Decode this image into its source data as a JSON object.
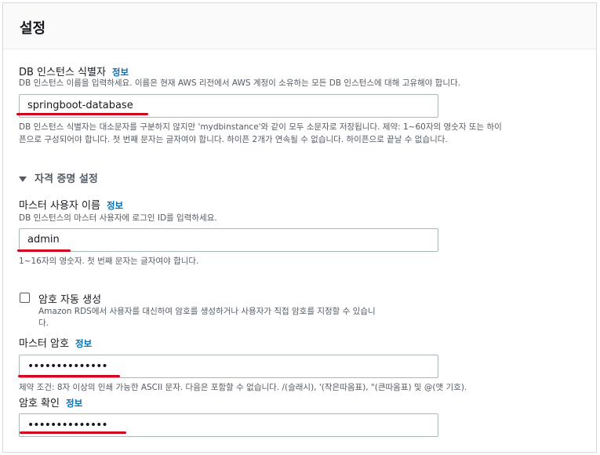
{
  "header": {
    "title": "설정"
  },
  "identifier": {
    "label": "DB 인스턴스 식별자",
    "info": "정보",
    "description": "DB 인스턴스 이름을 입력하세요. 이름은 현재 AWS 리전에서 AWS 계정이 소유하는 모든 DB 인스턴스에 대해 고유해야 합니다.",
    "value": "springboot-database",
    "constraint_line1": "DB 인스턴스 식별자는 대소문자를 구분하지 않지만 'mydbinstance'와 같이 모두 소문자로 저장됩니다. 제약: 1~60자의 영숫자 또는 하이",
    "constraint_line2": "픈으로 구성되어야 합니다. 첫 번째 문자는 글자여야 합니다. 하이픈 2개가 연속될 수 없습니다. 하이픈으로 끝날 수 없습니다."
  },
  "credentials": {
    "section_label": "자격 증명 설정",
    "username": {
      "label": "마스터 사용자 이름",
      "info": "정보",
      "description": "DB 인스턴스의 마스터 사용자에 로그인 ID를 입력하세요.",
      "value": "admin",
      "constraint": "1~16자의 영숫자. 첫 번째 문자는 글자여야 합니다."
    },
    "auto_password": {
      "label": "암호 자동 생성",
      "checked": false,
      "description_line1": "Amazon RDS에서 사용자를 대신하여 암호를 생성하거나 사용자가 직접 암호를 지정할 수 있습니",
      "description_line2": "다."
    },
    "password": {
      "label": "마스터 암호",
      "info": "정보",
      "value": "••••••••••••••",
      "constraint": "제약 조건: 8자 이상의 인쇄 가능한 ASCII 문자. 다음은 포함할 수 없습니다. /(슬래시), '(작은따옴표), \"(큰따옴표) 및 @(앳 기호)."
    },
    "confirm": {
      "label": "암호 확인",
      "info": "정보",
      "value": "••••••••••••••"
    }
  },
  "colors": {
    "annotation": "#d0021b",
    "link": "#0073bb"
  },
  "icons": {
    "section_toggle": "caret-down-icon"
  }
}
